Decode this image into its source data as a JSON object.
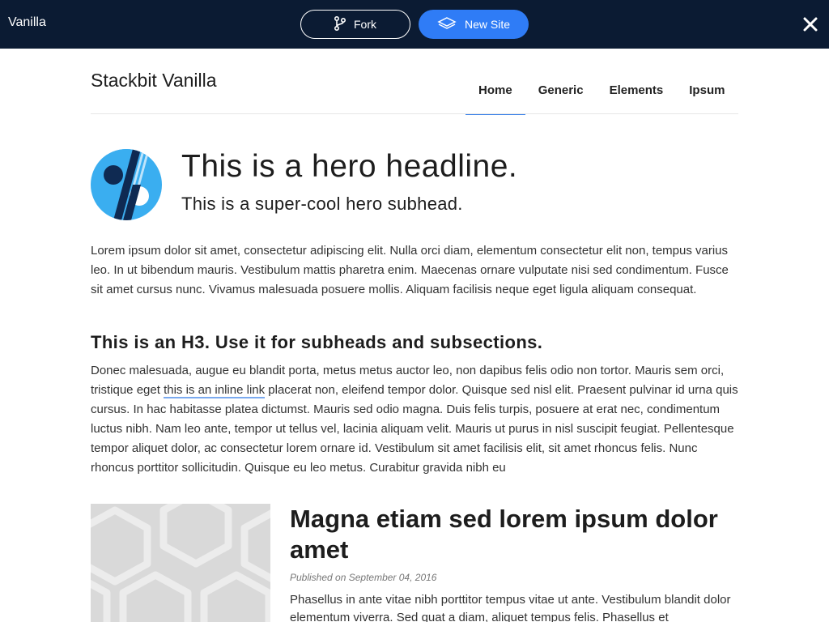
{
  "topbar": {
    "title": "Vanilla",
    "fork_label": "Fork",
    "new_site_label": "New Site",
    "bg_color": "#0b1b33",
    "accent_color": "#2f7cf6"
  },
  "site": {
    "title": "Stackbit Vanilla"
  },
  "nav": {
    "items": [
      {
        "label": "Home",
        "active": true
      },
      {
        "label": "Generic",
        "active": false
      },
      {
        "label": "Elements",
        "active": false
      },
      {
        "label": "Ipsum",
        "active": false
      }
    ]
  },
  "hero": {
    "headline": "This is a hero headline.",
    "subhead": "This is a super-cool hero subhead."
  },
  "content": {
    "para1": "Lorem ipsum dolor sit amet, consectetur adipiscing elit. Nulla orci diam, elementum consectetur elit non, tempus varius leo. In ut bibendum mauris. Vestibulum mattis pharetra enim. Maecenas ornare vulputate nisi sed condimentum. Fusce sit amet cursus nunc. Vivamus malesuada posuere mollis. Aliquam facilisis neque eget ligula aliquam consequat.",
    "h3": "This is an H3. Use it for subheads and subsections.",
    "para2_before": "Donec malesuada, augue eu blandit porta, metus metus auctor leo, non dapibus felis odio non tortor. Mauris sem orci, tristique eget ",
    "inline_link": "this is an inline link",
    "para2_after": " placerat non, eleifend tempor dolor. Quisque sed nisl elit. Praesent pulvinar id urna quis cursus. In hac habitasse platea dictumst. Mauris sed odio magna. Duis felis turpis, posuere at erat nec, condimentum luctus nibh. Nam leo ante, tempor ut tellus vel, lacinia aliquam velit. Mauris ut purus in nisl suscipit feugiat. Pellentesque tempor aliquet dolor, ac consectetur lorem ornare id. Vestibulum sit amet facilisis elit, sit amet rhoncus felis. Nunc rhoncus porttitor sollicitudin. Quisque eu leo metus. Curabitur gravida nibh eu"
  },
  "post": {
    "title": "Magna etiam sed lorem ipsum dolor amet",
    "date": "Published on September 04, 2016",
    "excerpt": "Phasellus in ante vitae nibh porttitor tempus vitae ut ante. Vestibulum blandit dolor elementum viverra. Sed quat a diam, aliquet tempus felis. Phasellus et"
  }
}
